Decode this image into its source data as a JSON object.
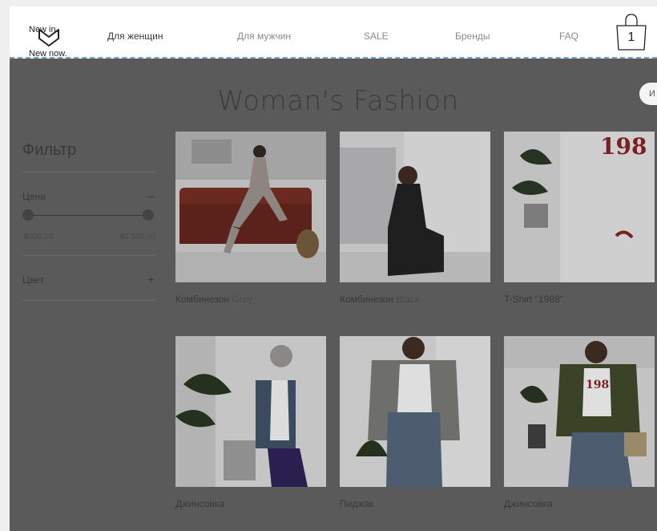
{
  "header": {
    "logo_line1": "New in.",
    "logo_line2": "New now.",
    "nav": [
      {
        "label": "Для женщин",
        "active": true
      },
      {
        "label": "Для мужчин",
        "active": false
      },
      {
        "label": "SALE",
        "active": false
      },
      {
        "label": "Бренды",
        "active": false
      },
      {
        "label": "FAQ",
        "active": false
      }
    ],
    "cart_count": "1"
  },
  "page_title": "Woman's Fashion",
  "side_button_label": "И",
  "filter": {
    "title": "Фильтр",
    "price_label": "Цена",
    "price_toggle": "–",
    "price_min": "₴500,00",
    "price_max": "₴2 500,00",
    "color_label": "Цвет",
    "color_toggle": "+"
  },
  "products": [
    {
      "name": "Комбинезон",
      "variant": "Grey"
    },
    {
      "name": "Комбинезон",
      "variant": "Black"
    },
    {
      "name": "T-Shirt \"1988\"",
      "variant": ""
    },
    {
      "name": "Джинсовка",
      "variant": ""
    },
    {
      "name": "Пиджак",
      "variant": ""
    },
    {
      "name": "Джинсовка",
      "variant": ""
    }
  ],
  "colors": {
    "overlay": "#5b5a5a",
    "accent_line": "#6fa3c9"
  }
}
